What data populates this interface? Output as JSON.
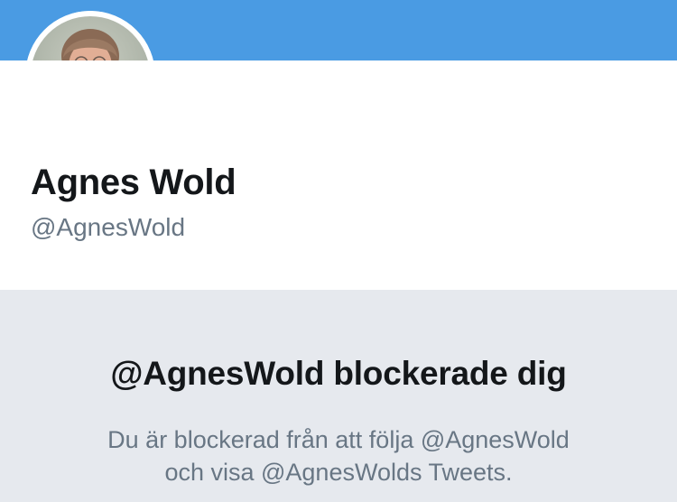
{
  "profile": {
    "display_name": "Agnes Wold",
    "handle": "@AgnesWold",
    "banner_color": "#4a9be3",
    "avatar_icon": "profile-photo"
  },
  "blocked": {
    "title": "@AgnesWold blockerade dig",
    "description_line1": "Du är blockerad från att följa @AgnesWold",
    "description_line2": "och visa @AgnesWolds Tweets.",
    "background_color": "#e6e9ee"
  }
}
